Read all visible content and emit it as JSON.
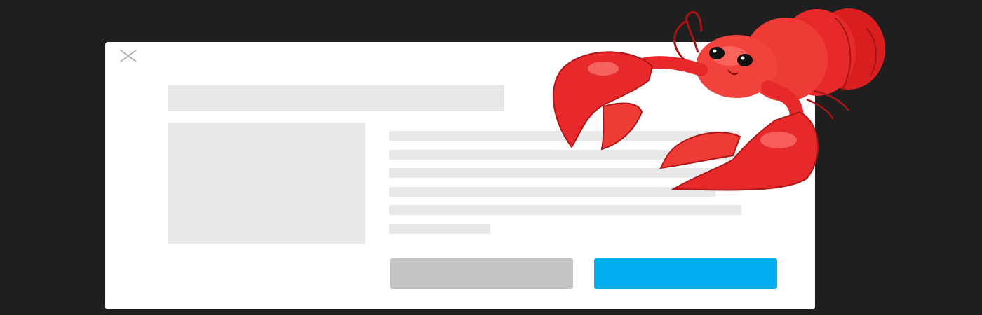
{
  "dialog": {
    "close_icon": "close-icon",
    "secondary_button_label": "",
    "primary_button_label": "",
    "colors": {
      "backdrop": "#1f1f1f",
      "panel": "#ffffff",
      "placeholder": "#e8e8e8",
      "secondary_button": "#c4c4c4",
      "primary_button": "#00aeef"
    }
  },
  "mascot": {
    "icon": "lobster-icon",
    "color": "#e8292b"
  }
}
